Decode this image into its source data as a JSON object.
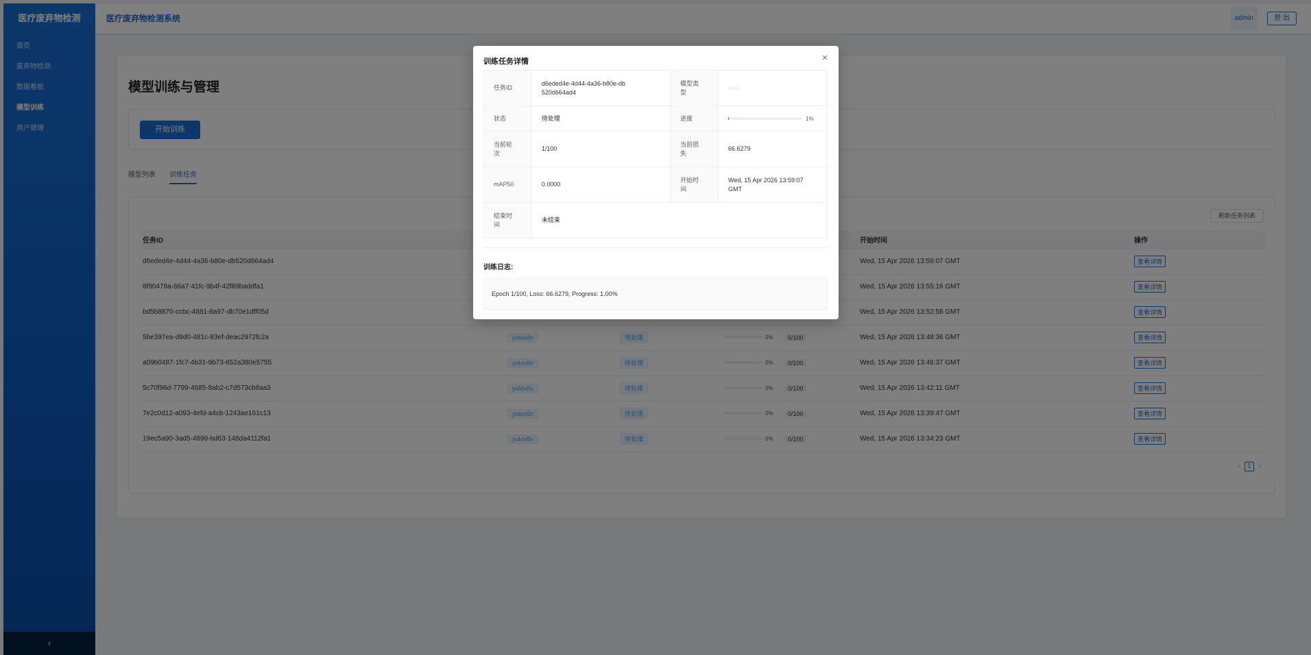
{
  "sidebar": {
    "brand": "医疗废弃物检测",
    "items": [
      {
        "label": "首页"
      },
      {
        "label": "废弃物检测"
      },
      {
        "label": "数据看板"
      },
      {
        "label": "模型训练"
      },
      {
        "label": "用户管理"
      }
    ],
    "active_index": 3,
    "collapse_icon": "‹"
  },
  "header": {
    "system_title": "医疗废弃物检测系统",
    "user": "admin",
    "logout_label": "登 出"
  },
  "page": {
    "title": "模型训练与管理",
    "start_button": "开始训练",
    "tabs": [
      {
        "label": "模型列表"
      },
      {
        "label": "训练任务"
      }
    ],
    "active_tab": 1,
    "refresh_button": "刷新任务列表",
    "columns": {
      "id": "任务ID",
      "start_time": "开始时间",
      "action": "操作"
    },
    "rows": [
      {
        "id": "d6eded4e-4d44-4a36-b80e-db520d664ad4",
        "model": "",
        "status": "",
        "progress": null,
        "epoch": "",
        "start": "Wed, 15 Apr 2026 13:59:07 GMT",
        "action": "查看详情"
      },
      {
        "id": "8f90478a-66a7-41fc-9b4f-42f89baddfa1",
        "model": "",
        "status": "",
        "progress": null,
        "epoch": "",
        "start": "Wed, 15 Apr 2026 13:55:16 GMT",
        "action": "查看详情"
      },
      {
        "id": "bd5b8870-ccbc-4881-8a97-db70e1dff05d",
        "model": "",
        "status": "",
        "progress": null,
        "epoch": "",
        "start": "Wed, 15 Apr 2026 13:52:58 GMT",
        "action": "查看详情"
      },
      {
        "id": "5be397ea-d9d0-481c-83ef-deac2972fc2a",
        "model": "yolov8n",
        "status": "待处理",
        "progress": "0%",
        "progress_value": 0,
        "epoch": "0/100",
        "start": "Wed, 15 Apr 2026 13:48:36 GMT",
        "action": "查看详情"
      },
      {
        "id": "a09b0487-1fc7-4b31-9b73-652a380e5755",
        "model": "yolov8n",
        "status": "待处理",
        "progress": "0%",
        "progress_value": 0,
        "epoch": "0/100",
        "start": "Wed, 15 Apr 2026 13:46:37 GMT",
        "action": "查看详情"
      },
      {
        "id": "5c70f96d-7799-4685-8ab2-c7d573cb8aa3",
        "model": "yolov8n",
        "status": "待处理",
        "progress": "0%",
        "progress_value": 0,
        "epoch": "0/100",
        "start": "Wed, 15 Apr 2026 13:42:11 GMT",
        "action": "查看详情"
      },
      {
        "id": "7e2c0d12-a093-4efd-a4cb-1243ae161c13",
        "model": "yolov8n",
        "status": "待处理",
        "progress": "0%",
        "progress_value": 0,
        "epoch": "0/100",
        "start": "Wed, 15 Apr 2026 13:39:47 GMT",
        "action": "查看详情"
      },
      {
        "id": "19ec5a90-3ad5-4899-bd63-148da4112fa1",
        "model": "yolov8n",
        "status": "待处理",
        "progress": "0%",
        "progress_value": 0,
        "epoch": "0/100",
        "start": "Wed, 15 Apr 2026 13:34:23 GMT",
        "action": "查看详情"
      }
    ],
    "pagination": {
      "prev": "‹",
      "current": "1",
      "next": "›"
    }
  },
  "modal": {
    "title": "训练任务详情",
    "close_icon": "×",
    "labels": {
      "task_id": "任务ID",
      "model_type": "模型类型",
      "status": "状态",
      "progress": "进度",
      "current_epoch": "当前轮次",
      "current_loss": "当前损失",
      "map50": "mAP50",
      "start_time": "开始时间",
      "end_time": "结束时间"
    },
    "values": {
      "task_id": "d6eded4e-4d44-4a36-b80e-db520d664ad4",
      "status": "待处理",
      "progress_text": "1%",
      "progress_value": 0.01,
      "current_epoch": "1/100",
      "current_loss": "66.6279",
      "map50": "0.0000",
      "start_time": "Wed, 15 Apr 2026 13:59:07 GMT",
      "end_time": "未结束"
    },
    "log_title": "训练日志:",
    "log_text": "Epoch 1/100, Loss: 66.6279, Progress: 1.00%"
  },
  "colors": {
    "primary": "#1a6fd6",
    "sidebar_dark": "#03203f",
    "overlay": "rgba(0,0,0,0.5)"
  }
}
